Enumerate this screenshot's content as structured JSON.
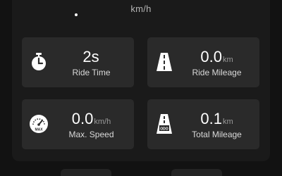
{
  "speedometer": {
    "unit": "km/h",
    "accent": "#c46a28"
  },
  "stats": [
    {
      "value": "2s",
      "unit": "",
      "label": "Ride Time",
      "icon": "stopwatch-icon"
    },
    {
      "value": "0.0",
      "unit": "km",
      "label": "Ride Mileage",
      "icon": "road-icon"
    },
    {
      "value": "0.0",
      "unit": "km/h",
      "label": "Max. Speed",
      "icon": "max-gauge-icon",
      "icon_text": "MAX"
    },
    {
      "value": "0.1",
      "unit": "km",
      "label": "Total Mileage",
      "icon": "odo-road-icon",
      "icon_text": "ODO"
    }
  ]
}
